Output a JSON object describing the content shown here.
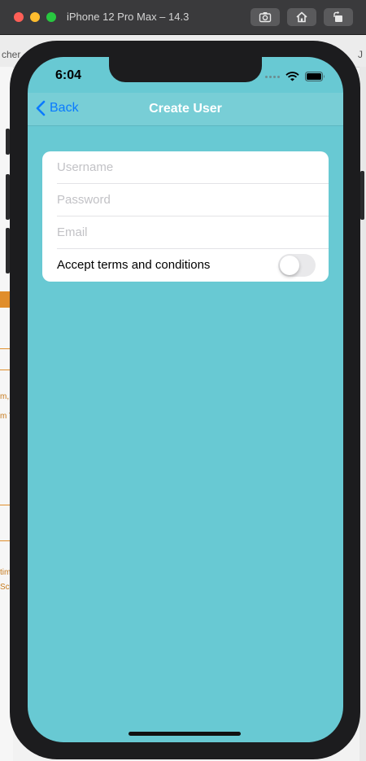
{
  "window": {
    "title": "iPhone 12 Pro Max – 14.3"
  },
  "background": {
    "snippets": [
      "cher",
      "J",
      "m,",
      "m T",
      "tim",
      "Sca"
    ]
  },
  "status_bar": {
    "time": "6:04"
  },
  "nav": {
    "back_label": "Back",
    "title": "Create User"
  },
  "form": {
    "username_placeholder": "Username",
    "password_placeholder": "Password",
    "email_placeholder": "Email",
    "terms_label": "Accept terms and conditions",
    "terms_accepted": false
  },
  "colors": {
    "screen_background": "#68c9d3",
    "navbar_background": "#78ced6",
    "accent": "#0a7aff",
    "switch_off": "#e9e9eb"
  }
}
